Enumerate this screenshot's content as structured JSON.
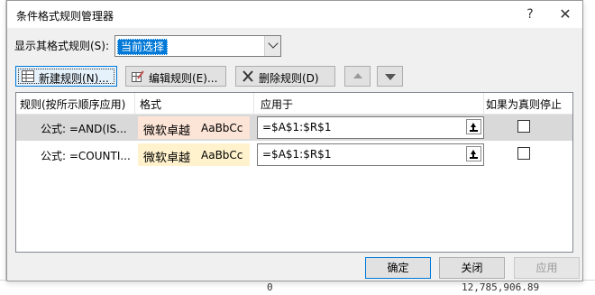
{
  "window": {
    "title": "条件格式规则管理器",
    "help_label": "?",
    "close_label": "✕"
  },
  "scope": {
    "label": "显示其格式规则(S):",
    "selected": "当前选择"
  },
  "toolbar": {
    "new_label": "新建规则(N)...",
    "edit_label": "编辑规则(E)...",
    "delete_label": "删除规则(D)"
  },
  "grid": {
    "headers": [
      "规则(按所示顺序应用)",
      "格式",
      "应用于",
      "如果为真则停止"
    ],
    "rows": [
      {
        "rule": "公式: =AND(IS...",
        "format_zh": "微软卓越",
        "format_en": "AaBbCc",
        "format_bg": "#fce4d6",
        "applies_to": "=$A$1:$R$1",
        "stop_if_true": false,
        "selected": true
      },
      {
        "rule": "公式: =COUNTI...",
        "format_zh": "微软卓越",
        "format_en": "AaBbCc",
        "format_bg": "#fff2cc",
        "applies_to": "=$A$1:$R$1",
        "stop_if_true": false,
        "selected": false
      }
    ]
  },
  "footer": {
    "ok_label": "确定",
    "cancel_label": "关闭",
    "apply_label": "应用"
  },
  "background": {
    "bottom_values": [
      "0",
      "12,785,906.89"
    ]
  },
  "colors": {
    "accent": "#0078d7",
    "dialog_bg": "#f0f0f0",
    "selected_row": "#d9d9d9"
  }
}
